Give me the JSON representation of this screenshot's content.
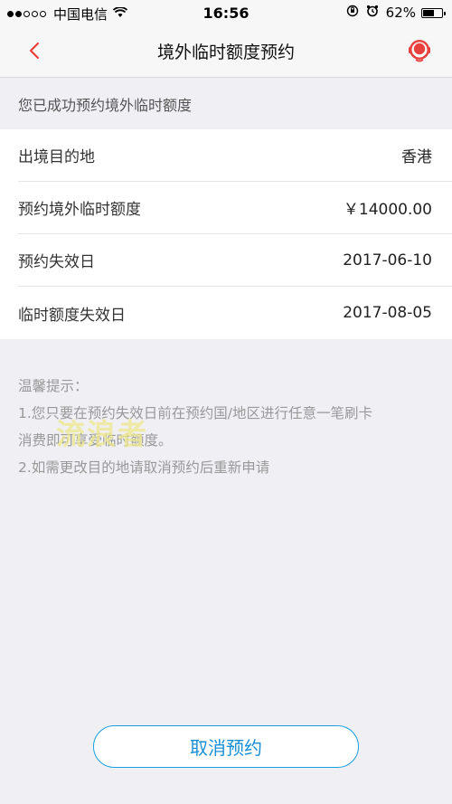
{
  "status_bar": {
    "carrier": "中国电信",
    "time": "16:56",
    "battery_percent": "62%",
    "battery_level": 0.62
  },
  "nav": {
    "title": "境外临时额度预约",
    "accent_color": "#e8403c"
  },
  "success_message": "您已成功预约境外临时额度",
  "details": [
    {
      "label": "出境目的地",
      "value": "香港"
    },
    {
      "label": "预约境外临时额度",
      "value": "￥14000.00"
    },
    {
      "label": "预约失效日",
      "value": "2017-06-10"
    },
    {
      "label": "临时额度失效日",
      "value": "2017-08-05"
    }
  ],
  "tips": {
    "title": "温馨提示：",
    "lines": [
      "1.您只要在预约失效日前在预约国/地区进行任意一笔刷卡",
      "消费即可享受临时额度。",
      "2.如需更改目的地请取消预约后重新申请"
    ]
  },
  "watermark": "流浪者",
  "cancel_button": {
    "label": "取消预约",
    "color": "#1aa0e0"
  }
}
